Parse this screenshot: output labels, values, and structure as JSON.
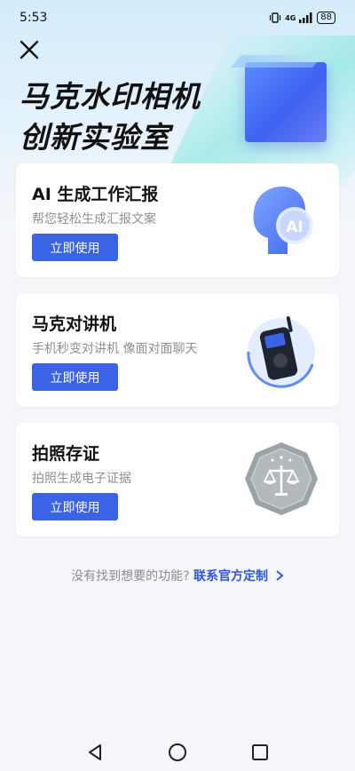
{
  "status": {
    "time": "5:53",
    "signal": "4G",
    "battery": "88"
  },
  "header": {
    "title_line1": "马克水印相机",
    "title_line2": "创新实验室"
  },
  "cards": [
    {
      "title": "AI 生成工作汇报",
      "subtitle": "帮您轻松生成汇报文案",
      "button": "立即使用",
      "art_text": "AI"
    },
    {
      "title": "马克对讲机",
      "subtitle": "手机秒变对讲机 像面对面聊天",
      "button": "立即使用"
    },
    {
      "title": "拍照存证",
      "subtitle": "拍照生成电子证据",
      "button": "立即使用"
    }
  ],
  "footer": {
    "prompt": "没有找到想要的功能?",
    "link": "联系官方定制"
  },
  "colors": {
    "accent": "#3a63e6",
    "link": "#2f56d8"
  }
}
